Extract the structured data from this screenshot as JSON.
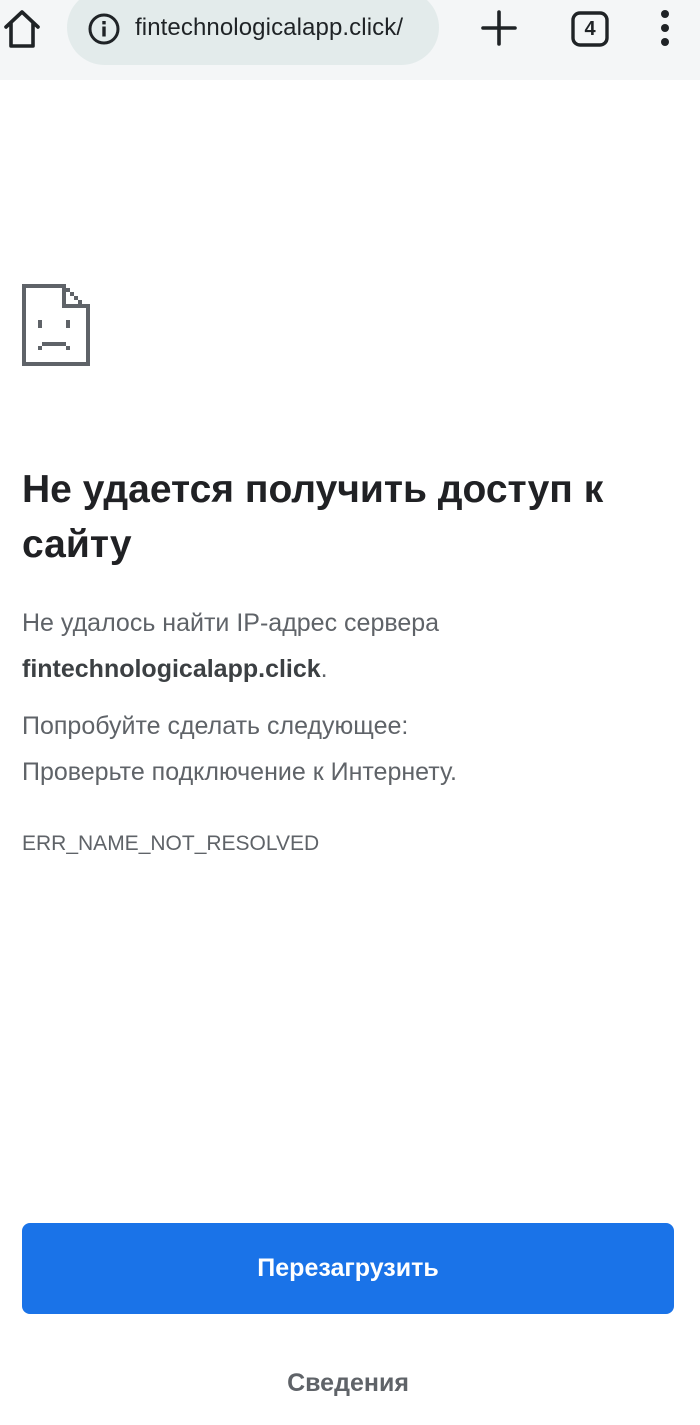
{
  "browser": {
    "url": "fintechnologicalapp.click/",
    "tab_count": "4",
    "icons": {
      "home": "home-icon",
      "site_info": "info-icon",
      "new_tab": "plus-icon",
      "tabs": "tab-switcher-icon",
      "menu": "more-vertical-icon"
    }
  },
  "error_page": {
    "icon": "sad-document-icon",
    "heading": "Не удается получить доступ к сайту",
    "description_prefix": "Не удалось найти IP-адрес сервера",
    "domain": "fintechnologicalapp.click",
    "description_suffix": ".",
    "suggestions_title": "Попробуйте сделать следующее:",
    "suggestions": [
      "Проверьте подключение к Интернету."
    ],
    "error_code": "ERR_NAME_NOT_RESOLVED",
    "reload_label": "Перезагрузить",
    "details_label": "Сведения"
  },
  "colors": {
    "toolbar_bg": "#f4f6f7",
    "omnibox_bg": "#e3ebeb",
    "primary_button": "#1a73e8",
    "heading_text": "#202124",
    "body_text": "#5f6368"
  }
}
